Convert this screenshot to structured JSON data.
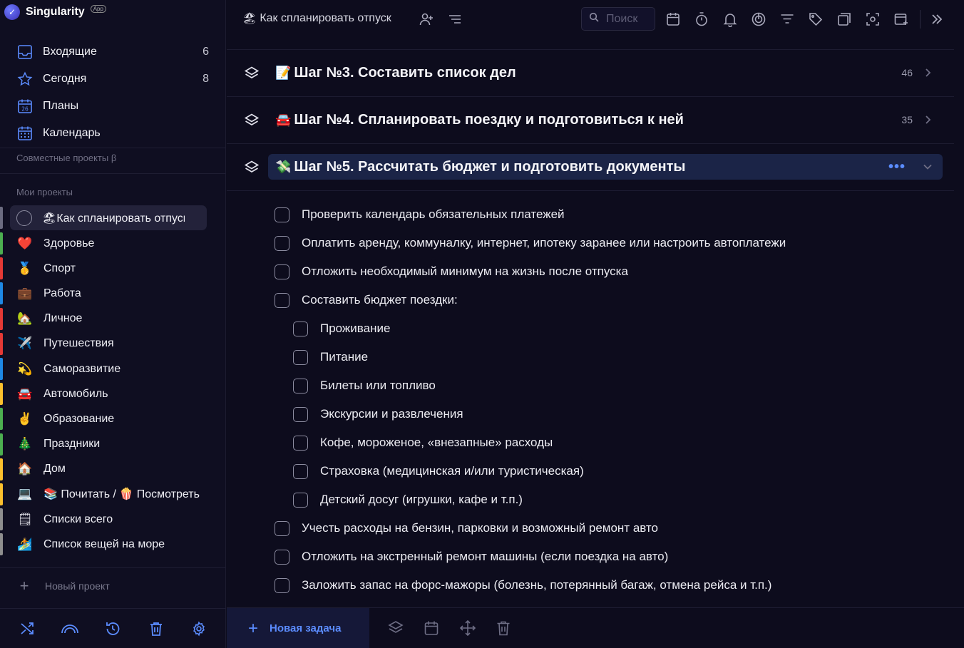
{
  "app": {
    "name": "Singularity",
    "badge": "App"
  },
  "nav": [
    {
      "label": "Входящие",
      "count": "6",
      "icon": "inbox-icon"
    },
    {
      "label": "Сегодня",
      "count": "8",
      "icon": "star-icon"
    },
    {
      "label": "Планы",
      "count": "",
      "icon": "calendar-26-icon"
    },
    {
      "label": "Календарь",
      "count": "",
      "icon": "calendar-grid-icon"
    }
  ],
  "sections_labels": {
    "shared": "Совместные проекты β",
    "mine": "Мои проекты"
  },
  "projects": [
    {
      "emoji": "🏖",
      "label": "Как спланировать отпуск",
      "color": "",
      "active": true
    },
    {
      "emoji": "❤️",
      "label": "Здоровье",
      "color": "#4caf50"
    },
    {
      "emoji": "🥇",
      "label": "Спорт",
      "color": "#e53935"
    },
    {
      "emoji": "💼",
      "label": "Работа",
      "color": "#1e88e5"
    },
    {
      "emoji": "🏡",
      "label": "Личное",
      "color": "#e53935"
    },
    {
      "emoji": "✈️",
      "label": "Путешествия",
      "color": "#e53935"
    },
    {
      "emoji": "💫",
      "label": "Саморазвитие",
      "color": "#1e88e5"
    },
    {
      "emoji": "🚘",
      "label": "Автомобиль",
      "color": "#fbc02d"
    },
    {
      "emoji": "✌️",
      "label": "Образование",
      "color": "#4caf50"
    },
    {
      "emoji": "🎄",
      "label": "Праздники",
      "color": "#4caf50"
    },
    {
      "emoji": "🏠",
      "label": "Дом",
      "color": "#fbc02d"
    },
    {
      "emoji": "💻",
      "label": "📚 Почитать / 🍿 Посмотреть",
      "color": "#fbc02d"
    },
    {
      "emoji": "🗒",
      "label": "Списки всего",
      "color": "#8e8e8e"
    },
    {
      "emoji": "🏄",
      "label": "Список вещей на море",
      "color": "#8e8e8e"
    }
  ],
  "new_project": "Новый проект",
  "header": {
    "project_emoji": "🏖",
    "project_title": "Как спланировать отпуск",
    "search_placeholder": "Поиск"
  },
  "sections": [
    {
      "emoji": "📝",
      "title": "Шаг №3. Составить список дел",
      "count": "46",
      "open": false
    },
    {
      "emoji": "🚘",
      "title": "Шаг №4. Спланировать поездку и подготовиться к ней",
      "count": "35",
      "open": false
    },
    {
      "emoji": "💸",
      "title": "Шаг №5. Рассчитать бюджет и подготовить документы",
      "count": "",
      "open": true
    }
  ],
  "tasks": [
    {
      "label": "Проверить календарь обязательных платежей",
      "level": 0
    },
    {
      "label": "Оплатить аренду, коммуналку, интернет, ипотеку заранее или настроить автоплатежи",
      "level": 0
    },
    {
      "label": "Отложить необходимый минимум на жизнь после отпуска",
      "level": 0
    },
    {
      "label": "Составить бюджет поездки:",
      "level": 0
    },
    {
      "label": "Проживание",
      "level": 1
    },
    {
      "label": "Питание",
      "level": 1
    },
    {
      "label": "Билеты или топливо",
      "level": 1
    },
    {
      "label": "Экскурсии и развлечения",
      "level": 1
    },
    {
      "label": "Кофе, мороженое, «внезапные» расходы",
      "level": 1
    },
    {
      "label": "Страховка (медицинская и/или туристическая)",
      "level": 1
    },
    {
      "label": "Детский досуг (игрушки, кафе и т.п.)",
      "level": 1
    },
    {
      "label": "Учесть расходы на бензин, парковки и возможный ремонт авто",
      "level": 0
    },
    {
      "label": "Отложить на экстренный ремонт машины (если поездка на авто)",
      "level": 0
    },
    {
      "label": "Заложить запас на форс-мажоры (болезнь, потерянный багаж, отмена рейса и т.п.)",
      "level": 0
    }
  ],
  "footer": {
    "new_task": "Новая задача"
  },
  "colors": {
    "accent": "#5b8cff",
    "background": "#0d0c1d",
    "open_section": "#1b2447"
  }
}
